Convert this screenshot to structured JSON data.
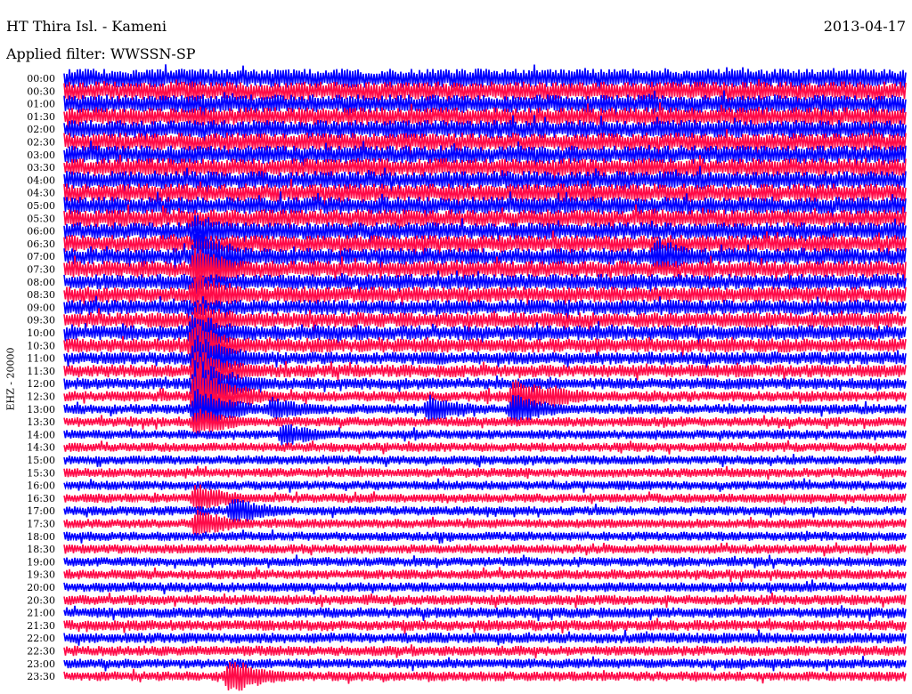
{
  "header": {
    "station": "HT Thira Isl. - Kameni",
    "date": "2013-04-17",
    "filter": "Applied filter: WWSSN-SP"
  },
  "chart_data": {
    "type": "line",
    "title": "HT Thira Isl. - Kameni",
    "ylabel": "EHZ - 20000",
    "xlabel": "",
    "minutes_per_line": 30,
    "colors": [
      "#0000ff",
      "#ff0a48"
    ],
    "row_labels": [
      "00:00",
      "00:30",
      "01:00",
      "01:30",
      "02:00",
      "02:30",
      "03:00",
      "03:30",
      "04:00",
      "04:30",
      "05:00",
      "05:30",
      "06:00",
      "06:30",
      "07:00",
      "07:30",
      "08:00",
      "08:30",
      "09:00",
      "09:30",
      "10:00",
      "10:30",
      "11:00",
      "11:30",
      "12:00",
      "12:30",
      "13:00",
      "13:30",
      "14:00",
      "14:30",
      "15:00",
      "15:30",
      "16:00",
      "16:30",
      "17:00",
      "17:30",
      "18:00",
      "18:30",
      "19:00",
      "19:30",
      "20:00",
      "20:30",
      "21:00",
      "21:30",
      "22:00",
      "22:30",
      "23:00",
      "23:30"
    ],
    "noise_amplitude_rows": [
      0.75,
      0.75,
      0.72,
      0.72,
      0.72,
      0.72,
      0.72,
      0.72,
      0.72,
      0.72,
      0.7,
      0.7,
      0.68,
      0.68,
      0.66,
      0.66,
      0.62,
      0.62,
      0.6,
      0.6,
      0.6,
      0.55,
      0.5,
      0.5,
      0.45,
      0.42,
      0.4,
      0.38,
      0.36,
      0.36,
      0.36,
      0.36,
      0.36,
      0.36,
      0.36,
      0.36,
      0.36,
      0.36,
      0.36,
      0.38,
      0.38,
      0.4,
      0.42,
      0.42,
      0.42,
      0.4,
      0.38,
      0.38
    ],
    "events": [
      {
        "row": 12,
        "minute": 4.7,
        "amplitude": 1.5
      },
      {
        "row": 14,
        "minute": 4.7,
        "amplitude": 2.5
      },
      {
        "row": 15,
        "minute": 4.7,
        "amplitude": 2.0
      },
      {
        "row": 14,
        "minute": 21.1,
        "amplitude": 1.6
      },
      {
        "row": 17,
        "minute": 4.7,
        "amplitude": 1.8
      },
      {
        "row": 19,
        "minute": 4.7,
        "amplitude": 1.6
      },
      {
        "row": 20,
        "minute": 4.6,
        "amplitude": 1.8
      },
      {
        "row": 21,
        "minute": 4.6,
        "amplitude": 2.0
      },
      {
        "row": 22,
        "minute": 4.7,
        "amplitude": 2.2
      },
      {
        "row": 23,
        "minute": 4.7,
        "amplitude": 2.0
      },
      {
        "row": 24,
        "minute": 4.7,
        "amplitude": 2.2
      },
      {
        "row": 25,
        "minute": 4.7,
        "amplitude": 2.5
      },
      {
        "row": 26,
        "minute": 4.7,
        "amplitude": 1.8
      },
      {
        "row": 26,
        "minute": 7.4,
        "amplitude": 1.0
      },
      {
        "row": 26,
        "minute": 13.0,
        "amplitude": 1.2
      },
      {
        "row": 26,
        "minute": 16.0,
        "amplitude": 1.3
      },
      {
        "row": 25,
        "minute": 16.0,
        "amplitude": 1.6
      },
      {
        "row": 25,
        "minute": 17.3,
        "amplitude": 1.0
      },
      {
        "row": 27,
        "minute": 4.7,
        "amplitude": 1.2
      },
      {
        "row": 28,
        "minute": 7.8,
        "amplitude": 1.0
      },
      {
        "row": 33,
        "minute": 4.7,
        "amplitude": 1.2
      },
      {
        "row": 34,
        "minute": 6.0,
        "amplitude": 1.2
      },
      {
        "row": 35,
        "minute": 4.7,
        "amplitude": 1.2
      },
      {
        "row": 47,
        "minute": 5.9,
        "amplitude": 1.5
      }
    ]
  }
}
